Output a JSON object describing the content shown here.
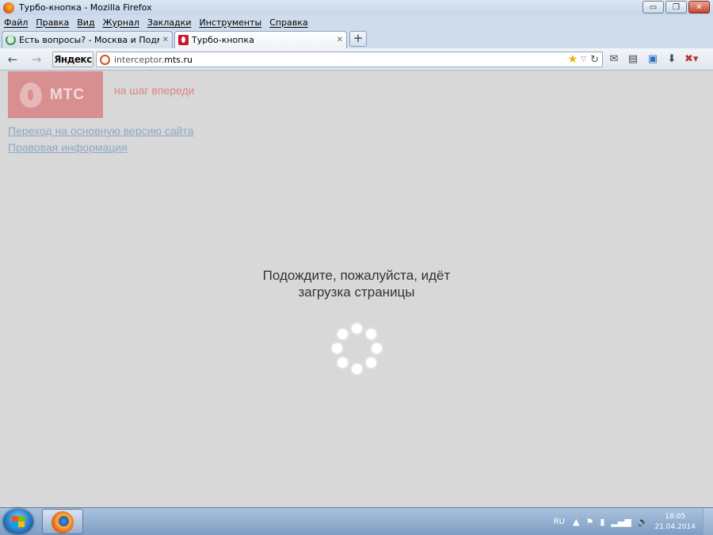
{
  "window": {
    "title": "Турбо-кнопка - Mozilla Firefox",
    "min_label": "▭",
    "max_label": "❐",
    "close_label": "✕"
  },
  "menu": [
    "Файл",
    "Правка",
    "Вид",
    "Журнал",
    "Закладки",
    "Инструменты",
    "Справка"
  ],
  "tabs": [
    {
      "label": "Есть вопросы? - Москва и Подмоск...",
      "close": "✕",
      "icon": "loading-spinner-icon"
    },
    {
      "label": "Турбо-кнопка",
      "close": "✕",
      "icon": "mts-favicon"
    }
  ],
  "new_tab_label": "+",
  "nav": {
    "back": "←",
    "forward": "→",
    "yandex_label": "Яндекс",
    "url_host_prefix": "interceptor.",
    "url_host_main": "mts.ru",
    "star": "★",
    "dropdown": "▽",
    "reload": "↻"
  },
  "page": {
    "logo_text": "МТС",
    "slogan": "на шаг впереди",
    "link_main": "Переход на основную версию сайта",
    "link_legal": "Правовая информация",
    "loading_line1": "Подождите, пожалуйста, идёт",
    "loading_line2": "загрузка страницы"
  },
  "taskbar": {
    "lang": "RU",
    "time": "18:05",
    "date": "21.04.2014"
  },
  "colors": {
    "mts_red": "#d78f8f",
    "link": "#8ea8c4",
    "page_bg": "#d8d8d8"
  }
}
